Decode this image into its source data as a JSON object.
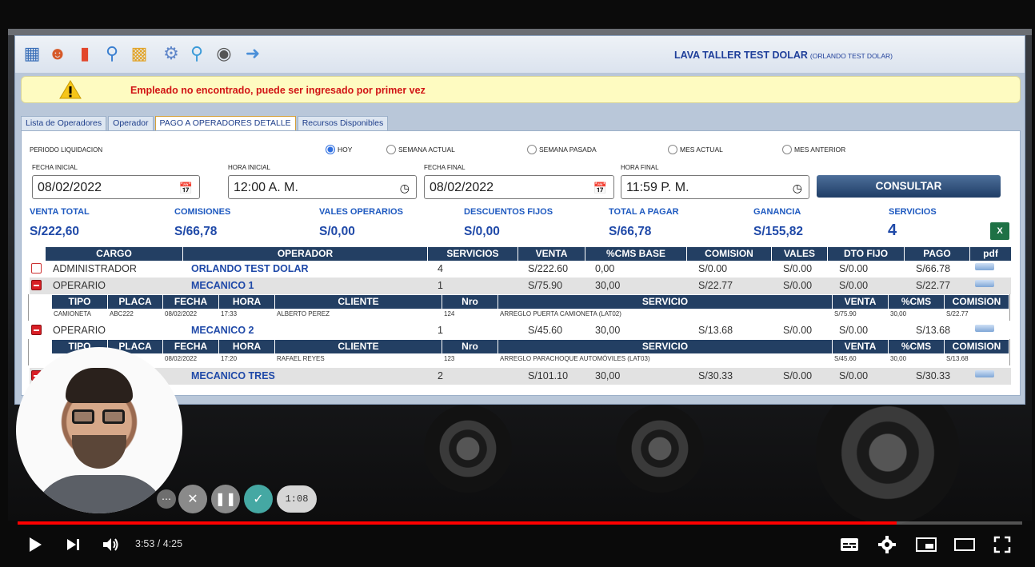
{
  "app": {
    "company_name": "LAVA TALLER TEST DOLAR",
    "company_user": "(ORLANDO TEST DOLAR)",
    "toolbar_icons": [
      "register-icon",
      "users-icon",
      "chart-icon",
      "search-icon",
      "calculator-icon",
      "settings-icon",
      "find-icon",
      "user-circle-icon",
      "arrow-right-icon"
    ]
  },
  "alert": {
    "message": "Empleado no encontrado, puede ser ingresado por primer vez"
  },
  "tabs": [
    "Lista de Operadores",
    "Operador",
    "PAGO A OPERADORES DETALLE",
    "Recursos Disponibles"
  ],
  "filters": {
    "period_label": "PERIODO LIQUIDACION",
    "options": [
      {
        "label": "HOY",
        "selected": true
      },
      {
        "label": "SEMANA ACTUAL",
        "selected": false
      },
      {
        "label": "SEMANA PASADA",
        "selected": false
      },
      {
        "label": "MES ACTUAL",
        "selected": false
      },
      {
        "label": "MES ANTERIOR",
        "selected": false
      }
    ],
    "fecha_inicial_label": "FECHA INICIAL",
    "fecha_inicial": "08/02/2022",
    "hora_inicial_label": "HORA INICIAL",
    "hora_inicial": "12:00 A. M.",
    "fecha_final_label": "FECHA FINAL",
    "fecha_final": "08/02/2022",
    "hora_final_label": "HORA FINAL",
    "hora_final": "11:59 P. M.",
    "consultar": "CONSULTAR"
  },
  "summary": [
    {
      "label": "VENTA TOTAL",
      "value": "S/222,60"
    },
    {
      "label": "COMISIONES",
      "value": "S/66,78"
    },
    {
      "label": "VALES OPERARIOS",
      "value": "S/0,00"
    },
    {
      "label": "DESCUENTOS FIJOS",
      "value": "S/0,00"
    },
    {
      "label": "TOTAL A PAGAR",
      "value": "S/66,78"
    },
    {
      "label": "GANANCIA",
      "value": "S/155,82"
    },
    {
      "label": "SERVICIOS",
      "value": "4"
    }
  ],
  "table": {
    "headers": [
      "CARGO",
      "OPERADOR",
      "SERVICIOS",
      "VENTA",
      "%CMS BASE",
      "COMISION",
      "VALES",
      "DTO FIJO",
      "PAGO",
      "pdf"
    ],
    "rows": [
      {
        "cargo": "ADMINISTRADOR",
        "operador": "ORLANDO TEST DOLAR",
        "servicios": "4",
        "venta": "S/222.60",
        "cms": "0,00",
        "comision": "S/0.00",
        "vales": "S/0.00",
        "dto": "S/0.00",
        "pago": "S/66.78"
      },
      {
        "cargo": "OPERARIO",
        "operador": "MECANICO 1",
        "servicios": "1",
        "venta": "S/75.90",
        "cms": "30,00",
        "comision": "S/22.77",
        "vales": "S/0.00",
        "dto": "S/0.00",
        "pago": "S/22.77"
      },
      {
        "cargo": "OPERARIO",
        "operador": "MECANICO 2",
        "servicios": "1",
        "venta": "S/45.60",
        "cms": "30,00",
        "comision": "S/13.68",
        "vales": "S/0.00",
        "dto": "S/0.00",
        "pago": "S/13.68"
      },
      {
        "cargo": "",
        "operador": "MECANICO TRES",
        "servicios": "2",
        "venta": "S/101.10",
        "cms": "30,00",
        "comision": "S/30.33",
        "vales": "S/0.00",
        "dto": "S/0.00",
        "pago": "S/30.33"
      }
    ],
    "sub_headers": [
      "TIPO",
      "PLACA",
      "FECHA",
      "HORA",
      "CLIENTE",
      "Nro",
      "SERVICIO",
      "VENTA",
      "%CMS",
      "COMISION"
    ],
    "sub_rows": [
      {
        "tipo": "CAMIONETA",
        "placa": "ABC222",
        "fecha": "08/02/2022",
        "hora": "17:33",
        "cliente": "ALBERTO PEREZ",
        "nro": "124",
        "servicio": "ARREGLO PUERTA CAMIONETA (LAT02)",
        "venta": "S/75.90",
        "cms": "30,00",
        "comision": "S/22.77"
      },
      {
        "tipo": "",
        "placa": "",
        "fecha": "08/02/2022",
        "hora": "17:20",
        "cliente": "RAFAEL REYES",
        "nro": "123",
        "servicio": "ARREGLO PARACHOQUE AUTOMÓVILES (LAT03)",
        "venta": "S/45.60",
        "cms": "30,00",
        "comision": "S/13.68"
      }
    ]
  },
  "recorder": {
    "timer": "1:08"
  },
  "player": {
    "time": "3:53 / 4:25",
    "progress": 0.875
  }
}
